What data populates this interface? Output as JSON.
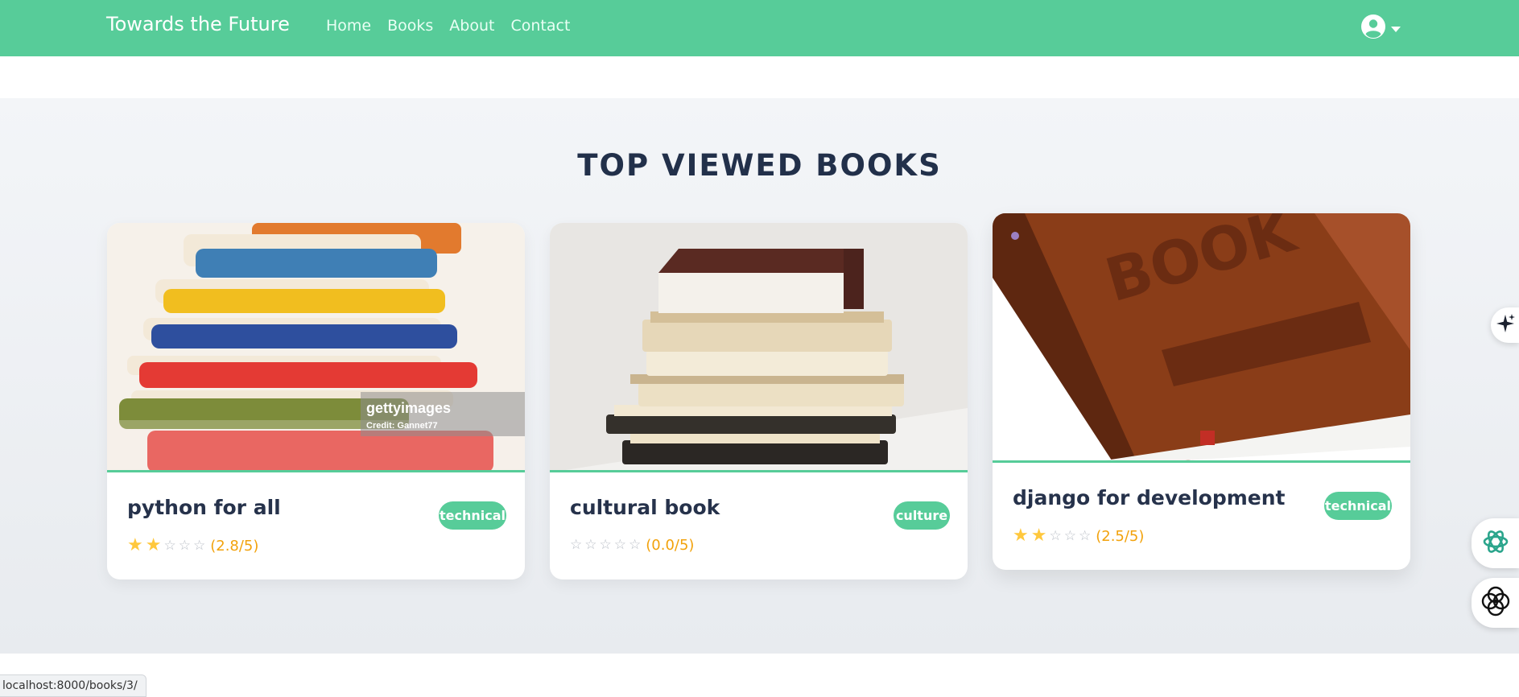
{
  "navbar": {
    "brand": "Towards the Future",
    "links": [
      "Home",
      "Books",
      "About",
      "Contact"
    ],
    "user_icon": "user-circle-icon"
  },
  "section": {
    "title": "TOP VIEWED BOOKS"
  },
  "books": [
    {
      "title": "python for all",
      "category": "technical",
      "rating": 2.8,
      "rating_text": "(2.8/5)",
      "image_overlay_line1": "gettyimages",
      "image_overlay_line2": "Credit: Gannet77"
    },
    {
      "title": "cultural book",
      "category": "culture",
      "rating": 0.0,
      "rating_text": "(0.0/5)"
    },
    {
      "title": "django for development",
      "category": "technical",
      "rating": 2.5,
      "rating_text": "(2.5/5)",
      "image_cover_text": "BOOK"
    }
  ],
  "side_buttons": [
    "sparkle-icon",
    "openai-logo-icon",
    "flower-logo-icon"
  ],
  "status_bar": {
    "url": "localhost:8000/books/3/"
  },
  "colors": {
    "brand": "#57cc99",
    "title": "#22304a",
    "star": "#ffc83d",
    "score": "#f2a20c"
  }
}
